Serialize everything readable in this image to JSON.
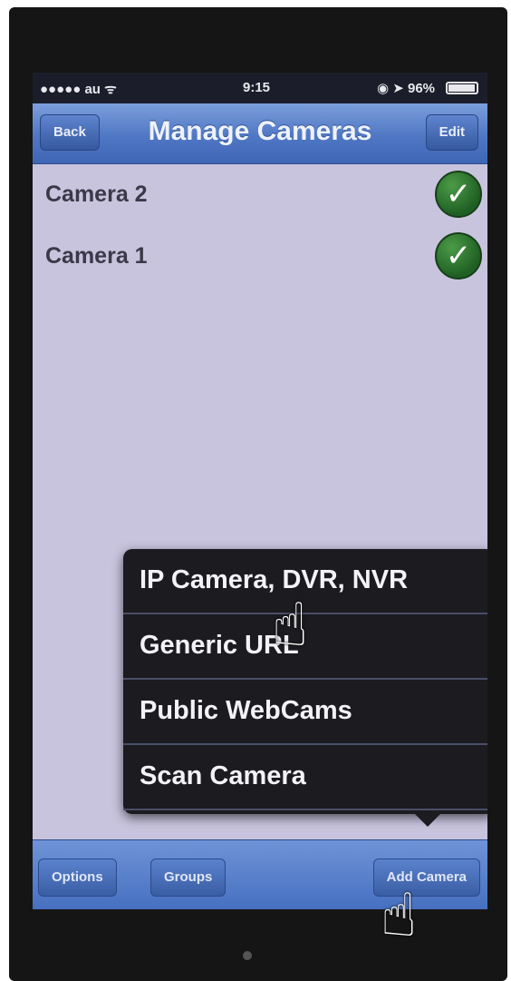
{
  "status_bar": {
    "carrier": "●●●●● au ᯤ",
    "time": "9:15",
    "indicators": "◉ ➤ 96% ",
    "battery_level": 0.96
  },
  "nav_bar": {
    "back_label": "Back",
    "title": "Manage Cameras",
    "edit_label": "Edit"
  },
  "cameras": [
    {
      "name": "Camera 2",
      "status_icon": "check-icon"
    },
    {
      "name": "Camera 1",
      "status_icon": "check-icon"
    }
  ],
  "add_camera_menu": {
    "items": [
      {
        "label": "IP Camera, DVR, NVR"
      },
      {
        "label": "Generic URL"
      },
      {
        "label": "Public WebCams"
      },
      {
        "label": "Scan Camera"
      }
    ]
  },
  "toolbar": {
    "options_label": "Options",
    "groups_label": "Groups",
    "add_camera_label": "Add Camera"
  },
  "colors": {
    "nav_blue": "#4f77c4",
    "list_background": "#c8c4de",
    "popover": "#1b1b20",
    "check_green": "#2f7a30"
  }
}
